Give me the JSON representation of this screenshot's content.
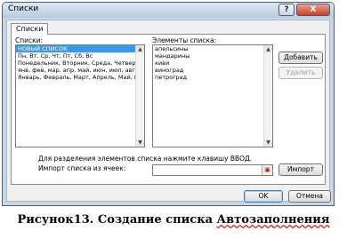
{
  "window": {
    "title": "Списки",
    "help_label": "?",
    "close_label": "X"
  },
  "tabs": [
    {
      "label": "Списки"
    }
  ],
  "lists_panel": {
    "label": "Списки:",
    "items": [
      "НОВЫЙ СПИСОК",
      "Пн, Вт, Ср, Чт, Пт, Сб, Вс",
      "Понедельник, Вторник, Среда, Четверг, П",
      "янв, фев, мар, апр, май, июн, июл, авг, се",
      "Январь, Февраль, Март, Апрель, Май, Июн"
    ],
    "selected_index": 0
  },
  "elements_panel": {
    "label": "Элементы списка:",
    "items": [
      "апельсины",
      "мандарины",
      "киви",
      "виноград",
      "петроград"
    ]
  },
  "buttons": {
    "add": "Добавить",
    "delete": "Удалить",
    "import": "Импорт",
    "ok": "OK",
    "cancel": "Отмена"
  },
  "hint_text": "Для разделения элементов списка нажмите клавишу ВВОД.",
  "import_label": "Импорт списка из ячеек:",
  "import_value": "",
  "caption": {
    "prefix": "Рисунок13. Создание списка ",
    "underlined": "Автозаполнения"
  }
}
